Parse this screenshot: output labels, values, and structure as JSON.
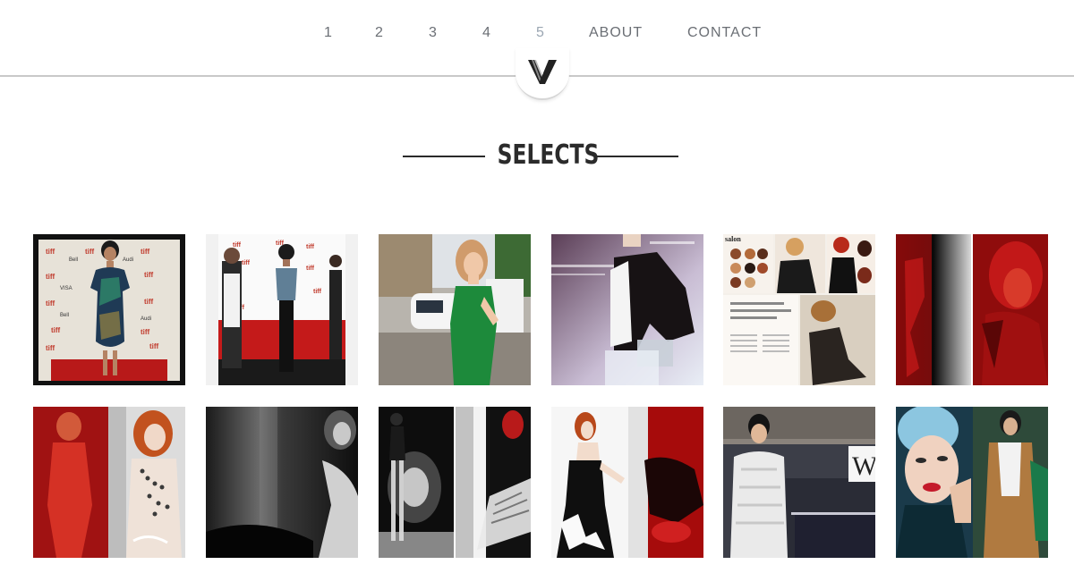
{
  "nav": {
    "items": [
      {
        "label": "1",
        "active": false
      },
      {
        "label": "2",
        "active": false
      },
      {
        "label": "3",
        "active": false
      },
      {
        "label": "4",
        "active": false
      },
      {
        "label": "5",
        "active": true
      },
      {
        "label": "ABOUT",
        "active": false
      },
      {
        "label": "CONTACT",
        "active": false
      }
    ]
  },
  "logo": {
    "icon": "v-monogram-icon"
  },
  "section": {
    "title": "SELECTS"
  },
  "gallery": {
    "rows": [
      [
        {
          "name": "photo-red-carpet-tiff-floral-dress"
        },
        {
          "name": "photo-red-carpet-interview"
        },
        {
          "name": "photo-green-dress-street"
        },
        {
          "name": "photo-black-jacket-editorial"
        },
        {
          "name": "photo-salon-magazine-spread"
        },
        {
          "name": "photo-red-xray-spread"
        }
      ],
      [
        {
          "name": "photo-red-portrait-spread"
        },
        {
          "name": "photo-monochrome-portrait"
        },
        {
          "name": "photo-black-white-dancer-spread"
        },
        {
          "name": "photo-red-hair-gown-spread"
        },
        {
          "name": "photo-white-coat-editorial"
        },
        {
          "name": "photo-blue-hair-spread"
        }
      ]
    ]
  }
}
